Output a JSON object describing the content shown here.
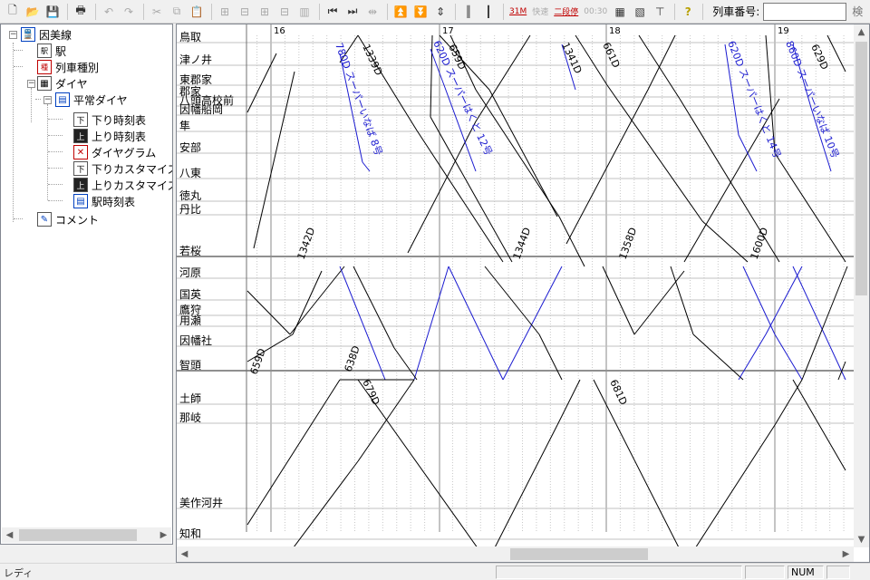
{
  "toolbar": {
    "icons": [
      {
        "name": "new-icon",
        "glyph": "🗋"
      },
      {
        "name": "open-icon",
        "glyph": "📂"
      },
      {
        "name": "save-icon",
        "glyph": "💾"
      },
      {
        "name": "print-icon",
        "glyph": "🖶"
      },
      {
        "name": "undo-icon",
        "glyph": "↶"
      },
      {
        "name": "redo-icon",
        "glyph": "↷"
      },
      {
        "name": "cut-icon",
        "glyph": "✂"
      },
      {
        "name": "copy-icon",
        "glyph": "⧉"
      },
      {
        "name": "paste-icon",
        "glyph": "📋"
      },
      {
        "name": "first-icon",
        "glyph": "⏮"
      },
      {
        "name": "next-icon",
        "glyph": "⏭"
      },
      {
        "name": "scroll-top-icon",
        "glyph": "⏫"
      },
      {
        "name": "scroll-bottom-icon",
        "glyph": "⏬"
      },
      {
        "name": "help-icon",
        "glyph": "?"
      }
    ],
    "toggle_31m": "31M",
    "toggle_rapid": "快速",
    "toggle_stop": "二段停",
    "toggle_time": "00:30",
    "train_no_label": "列車番号:",
    "train_no_value": "",
    "search_label": "検"
  },
  "tree": {
    "root": "因美線",
    "station": "駅",
    "train_type": "列車種別",
    "dia": "ダイヤ",
    "normal_dia": "平常ダイヤ",
    "down_timetable": "下り時刻表",
    "up_timetable": "上り時刻表",
    "diagram": "ダイヤグラム",
    "down_custom": "下りカスタマイズ時",
    "up_custom": "上りカスタマイズ時",
    "station_timetable": "駅時刻表",
    "comment": "コメント"
  },
  "diagram": {
    "hours": [
      "16",
      "17",
      "18",
      "19"
    ],
    "stations": [
      "鳥取",
      "津ノ井",
      "東郡家",
      "郡家",
      "八頭高校前",
      "因幡船岡",
      "隼",
      "安部",
      "八東",
      "徳丸",
      "丹比",
      "若桜",
      "河原",
      "国英",
      "鷹狩",
      "用瀬",
      "因幡社",
      "智頭",
      "土師",
      "那岐",
      "美作河井",
      "知和"
    ],
    "trains": [
      "780D スーパーいなば 8号",
      "1339D",
      "620D スーパーはくと 12号",
      "659D",
      "1341D",
      "661D",
      "620D スーパーはくと 14号",
      "860D スーパーいなば 10号",
      "629D",
      "1342D",
      "1344D",
      "1358D",
      "1600D",
      "659D",
      "638D",
      "679D",
      "681D"
    ],
    "colors": {
      "black_line": "#000000",
      "blue_line": "#1a1ad0",
      "grid": "#b8b8b8"
    }
  },
  "status": {
    "text": "レディ",
    "num": "NUM"
  }
}
